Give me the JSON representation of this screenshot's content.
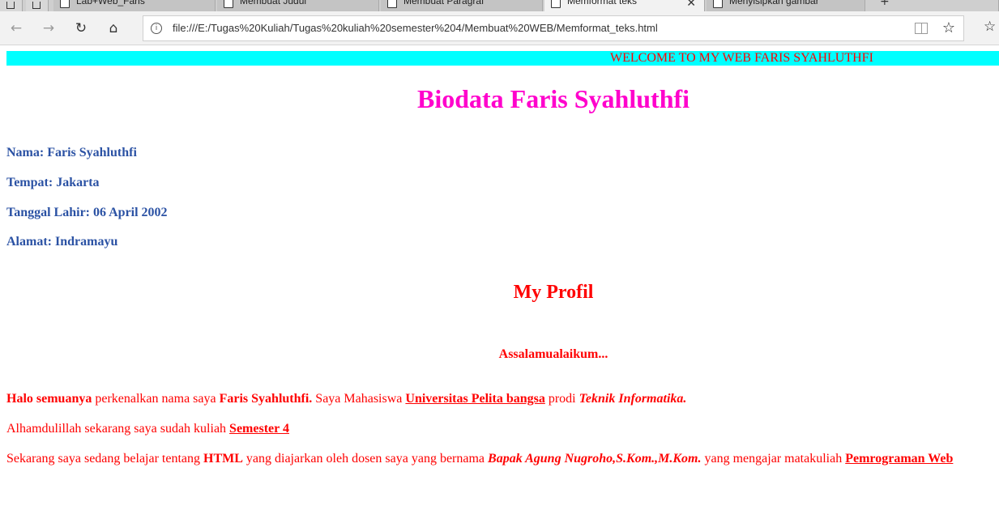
{
  "browser": {
    "tabs": [
      {
        "label": "Lab+Web_Faris",
        "active": false
      },
      {
        "label": "Membuat Judul",
        "active": false
      },
      {
        "label": "Membuat Paragraf",
        "active": false
      },
      {
        "label": "Memformat teks",
        "active": true
      },
      {
        "label": "Menyisipkan gambar",
        "active": false
      }
    ],
    "url": "file:///E:/Tugas%20Kuliah/Tugas%20kuliah%20semester%204/Membuat%20WEB/Memformat_teks.html",
    "accent": "#f2f2f2"
  },
  "page": {
    "marquee": "WELCOME TO MY WEB FARIS SYAHLUTHFI",
    "title": "Biodata Faris Syahluthfi",
    "bio": {
      "nama": "Nama: Faris Syahluthfi",
      "tempat": "Tempat: Jakarta",
      "tanggal": "Tanggal Lahir: 06 April 2002",
      "alamat": "Alamat: Indramayu"
    },
    "profile_title": "My Profil",
    "greeting": "Assalamualaikum...",
    "p1": {
      "a": "Halo semuanya",
      "b": " perkenalkan nama saya ",
      "c": "Faris Syahluthfi.",
      "d": " Saya Mahasiswa ",
      "e": "Universitas Pelita bangsa",
      "f": " prodi ",
      "g": "Teknik Informatika."
    },
    "p2": {
      "a": "Alhamdulillah sekarang saya sudah kuliah ",
      "b": "Semester 4"
    },
    "p3": {
      "a": "Sekarang saya sedang belajar tentang ",
      "b": "HTML",
      "c": " yang diajarkan oleh dosen saya yang bernama ",
      "d": "Bapak Agung Nugroho,S.Kom.,M.Kom.",
      "e": " yang mengajar matakuliah ",
      "f": "Pemrograman Web"
    },
    "colors": {
      "marquee_bg": "#00ffff",
      "title": "#ff00cc",
      "bio": "#2b52a4",
      "text": "#ff0000"
    }
  }
}
